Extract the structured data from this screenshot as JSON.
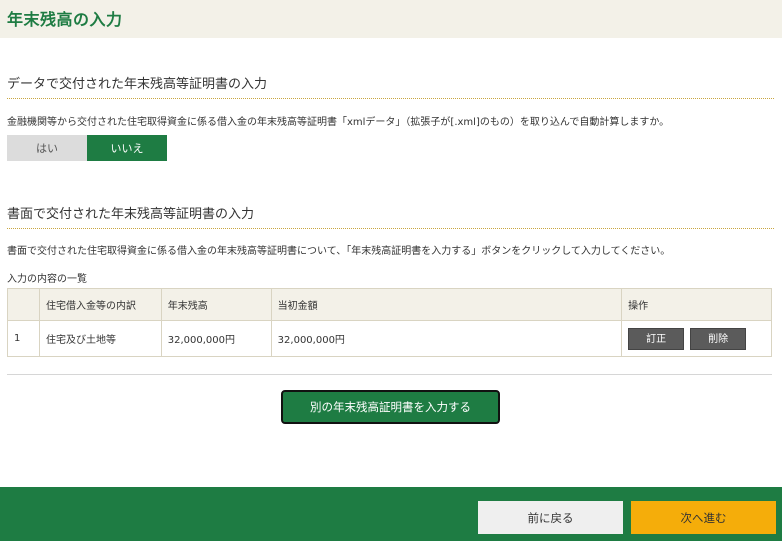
{
  "header": {
    "title": "年末残高の入力"
  },
  "data_section": {
    "heading": "データで交付された年末残高等証明書の入力",
    "description": "金融機関等から交付された住宅取得資金に係る借入金の年末残高等証明書「xmlデータ」（拡張子が[.xml]のもの）を取り込んで自動計算しますか。",
    "yes_label": "はい",
    "no_label": "いいえ",
    "selected": "いいえ"
  },
  "paper_section": {
    "heading": "書面で交付された年末残高等証明書の入力",
    "description": "書面で交付された住宅取得資金に係る借入金の年末残高等証明書について、「年末残高証明書を入力する」ボタンをクリックして入力してください。",
    "list_caption": "入力の内容の一覧",
    "columns": [
      "",
      "住宅借入金等の内訳",
      "年末残高",
      "当初金額",
      "操作"
    ],
    "rows": [
      {
        "no": "1",
        "kind": "住宅及び土地等",
        "year_end": "32,000,000円",
        "initial": "32,000,000円"
      }
    ],
    "edit_label": "訂正",
    "delete_label": "削除",
    "add_label": "別の年末残高証明書を入力する"
  },
  "footer": {
    "back_label": "前に戻る",
    "next_label": "次へ進む"
  },
  "colors": {
    "brand_green": "#1e7c43",
    "next_orange": "#f5ad0a",
    "header_beige": "#f3f1e8"
  }
}
